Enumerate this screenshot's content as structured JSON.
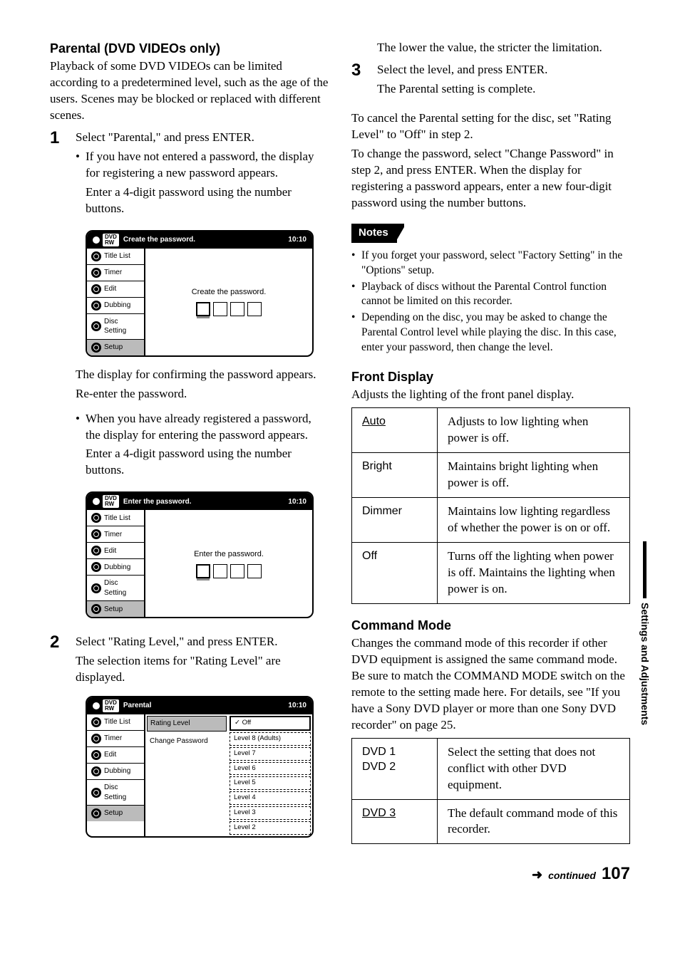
{
  "sideTab": "Settings and Adjustments",
  "left": {
    "heading": "Parental (DVD VIDEOs only)",
    "intro": "Playback of some DVD VIDEOs can be limited according to a predetermined level, such as the age of the users. Scenes may be blocked or replaced with different scenes.",
    "step1": {
      "num": "1",
      "line1": "Select \"Parental,\" and press ENTER.",
      "bullet1a": "If you have not entered a password, the display for registering a new password appears.",
      "bullet1b": "Enter a 4-digit password using the number buttons.",
      "after1a": "The display for confirming the password appears.",
      "after1b": "Re-enter the password.",
      "bullet2a": "When you have already registered a password, the display for entering the password appears.",
      "bullet2b": "Enter a 4-digit password using the number buttons."
    },
    "step2": {
      "num": "2",
      "line1": "Select \"Rating Level,\" and press ENTER.",
      "line2": "The selection items for \"Rating Level\" are displayed."
    },
    "ss": {
      "time": "10:10",
      "side": [
        "Title List",
        "Timer",
        "Edit",
        "Dubbing",
        "Disc Setting",
        "Setup"
      ],
      "create_title": "Create the password.",
      "create_prompt": "Create the password.",
      "enter_title": "Enter the password.",
      "enter_prompt": "Enter the password.",
      "parental_title": "Parental",
      "par_left": {
        "rating": "Rating Level",
        "change": "Change Password"
      },
      "par_right": [
        "Off",
        "Level 8 (Adults)",
        "Level 7",
        "Level 6",
        "Level 5",
        "Level 4",
        "Level 3",
        "Level 2"
      ],
      "check": "✓"
    }
  },
  "right": {
    "top1": "The lower the value, the stricter the limitation.",
    "step3": {
      "num": "3",
      "line1": "Select the level, and press ENTER.",
      "line2": "The Parental setting is complete."
    },
    "cancel": "To cancel the Parental setting for the disc, set \"Rating Level\" to \"Off\" in step 2.",
    "change": "To change the password, select \"Change Password\" in step 2, and press ENTER. When the display for registering a password appears, enter a new four-digit password using the number buttons.",
    "notesLabel": "Notes",
    "notes": [
      "If you forget your password, select \"Factory Setting\" in the \"Options\" setup.",
      "Playback of discs without the Parental Control function cannot be limited on this recorder.",
      "Depending on the disc, you may be asked to change the Parental Control level while playing the disc. In this case, enter your password, then change the level."
    ],
    "front": {
      "heading": "Front Display",
      "intro": "Adjusts the lighting of the front panel display.",
      "rows": [
        {
          "k": "Auto",
          "v": "Adjusts to low lighting when power is off."
        },
        {
          "k": "Bright",
          "v": "Maintains bright lighting when power is off."
        },
        {
          "k": "Dimmer",
          "v": "Maintains low lighting regardless of whether the power is on or off."
        },
        {
          "k": "Off",
          "v": "Turns off the lighting when power is off. Maintains the lighting when power is on."
        }
      ]
    },
    "cmd": {
      "heading": "Command Mode",
      "intro": "Changes the command mode of this recorder if other DVD equipment is assigned the same command mode. Be sure to match the COMMAND MODE switch on the remote to the setting made here. For details, see \"If you have a Sony DVD player or more than one Sony DVD recorder\" on page 25.",
      "rows": [
        {
          "k1": "DVD 1",
          "k2": "DVD 2",
          "v": "Select the setting that does not conflict with other DVD equipment."
        },
        {
          "k1": "DVD 3",
          "v": "The default command mode of this recorder."
        }
      ]
    }
  },
  "footer": {
    "arrow": "➜",
    "cont": "continued",
    "page": "107"
  }
}
